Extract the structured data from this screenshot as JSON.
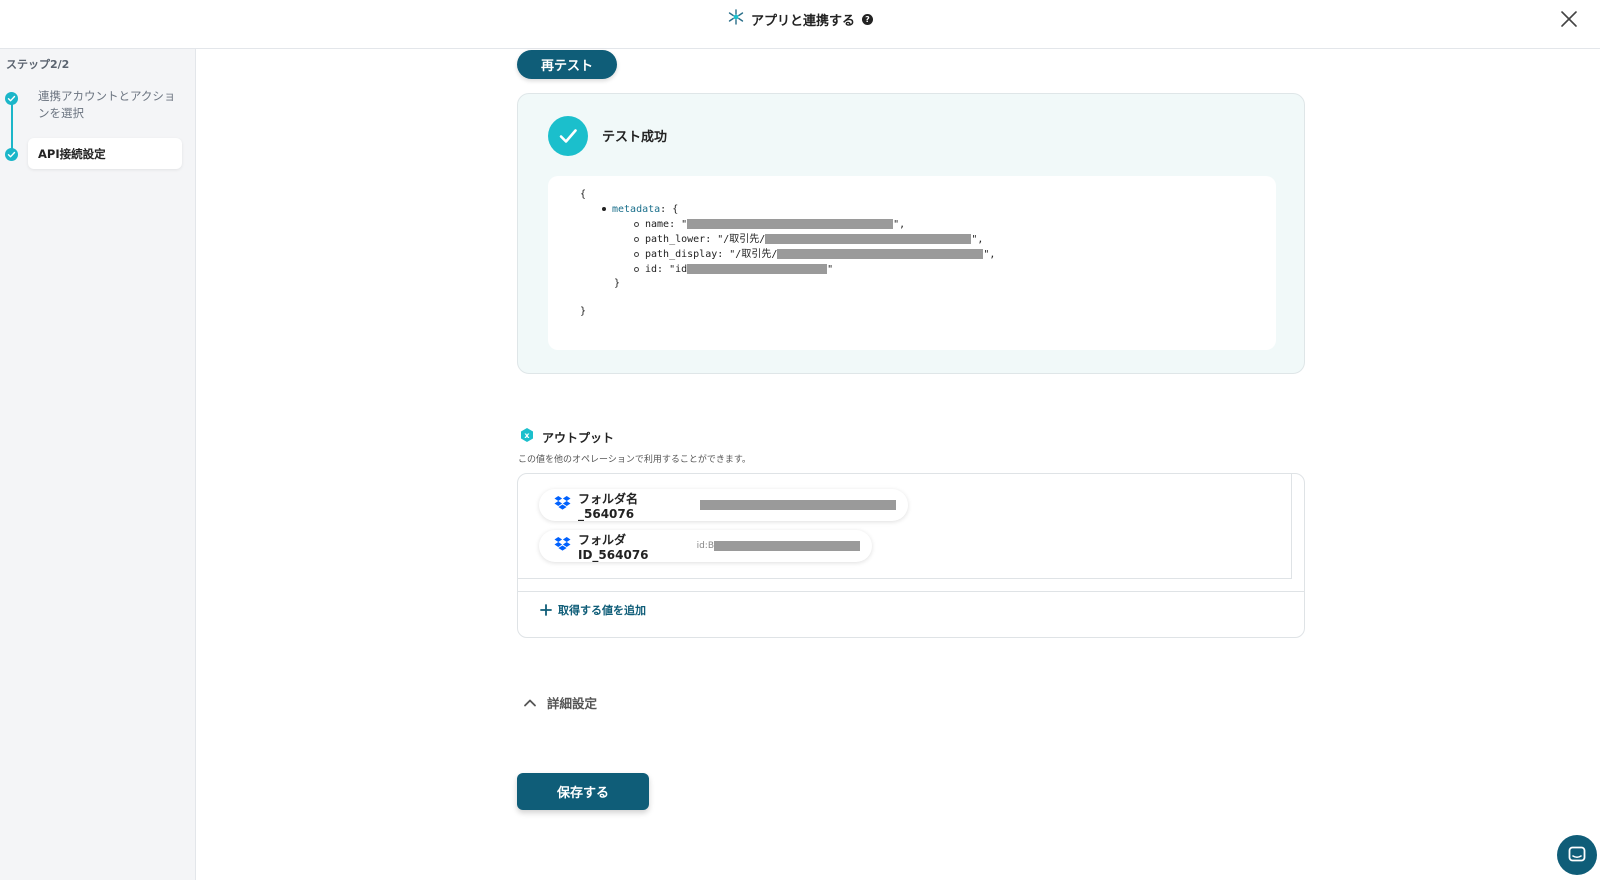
{
  "header": {
    "title": "アプリと連携する",
    "help_glyph": "?"
  },
  "sidebar": {
    "step_label": "ステップ2/2",
    "steps": [
      {
        "label": "連携アカウントとアクションを選択"
      },
      {
        "label": "API接続設定"
      }
    ]
  },
  "test": {
    "retest_label": "再テスト",
    "success_label": "テスト成功",
    "json": {
      "open_brace": "{",
      "metadata_key": "metadata",
      "metadata_open": ": {",
      "name_key": "name: \"",
      "name_end": "\",",
      "path_lower_key": "path_lower: \"/取引先/",
      "path_lower_end": "\",",
      "path_display_key": "path_display: \"/取引先/",
      "path_display_end": "\",",
      "id_key": "id: \"id",
      "id_end": "\"",
      "inner_close": "}",
      "close_brace": "}"
    }
  },
  "output": {
    "title": "アウトプット",
    "subtitle": "この値を他のオペレーションで利用することができます。",
    "chips": [
      {
        "label": "フォルダ名_564076",
        "value_prefix": ""
      },
      {
        "label": "フォルダID_564076",
        "value_prefix": "id:B"
      }
    ],
    "add_label": "取得する値を追加"
  },
  "details": {
    "label": "詳細設定"
  },
  "save_label": "保存する",
  "colors": {
    "primary": "#0f5d78",
    "accent": "#1bbfcc",
    "panel_bg": "#f1f9f9"
  }
}
